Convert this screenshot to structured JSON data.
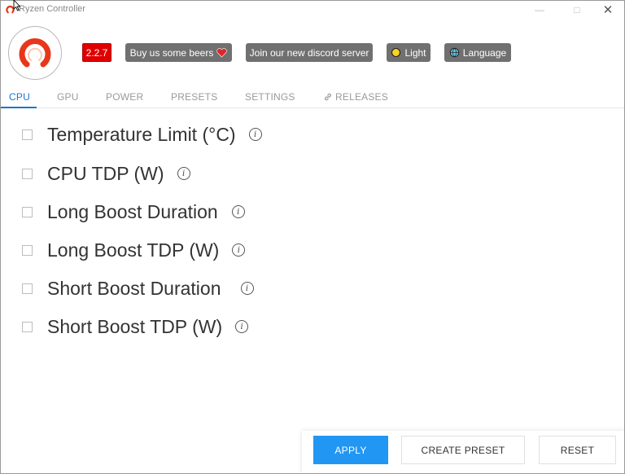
{
  "window": {
    "title": "Ryzen Controller"
  },
  "header": {
    "version": "2.2.7",
    "beers_label": "Buy us some beers",
    "discord_label": "Join our new discord server",
    "theme_label": "Light",
    "language_label": "Language"
  },
  "tabs": [
    {
      "label": "CPU",
      "active": true
    },
    {
      "label": "GPU"
    },
    {
      "label": "POWER"
    },
    {
      "label": "PRESETS"
    },
    {
      "label": "SETTINGS"
    },
    {
      "label": "RELEASES"
    }
  ],
  "options": [
    {
      "label": "Temperature Limit (°C)",
      "checked": false
    },
    {
      "label": "CPU TDP (W)",
      "checked": false
    },
    {
      "label": "Long Boost Duration",
      "checked": false
    },
    {
      "label": "Long Boost TDP (W)",
      "checked": false
    },
    {
      "label": "Short Boost Duration",
      "checked": false
    },
    {
      "label": "Short Boost TDP (W)",
      "checked": false
    }
  ],
  "footer": {
    "apply_label": "APPLY",
    "create_preset_label": "CREATE PRESET",
    "reset_label": "RESET"
  },
  "colors": {
    "accent": "#2196f3",
    "tab_active": "#1976d2",
    "logo_ring": "#e8361a",
    "version_badge": "#e00000",
    "header_button": "#707070"
  }
}
